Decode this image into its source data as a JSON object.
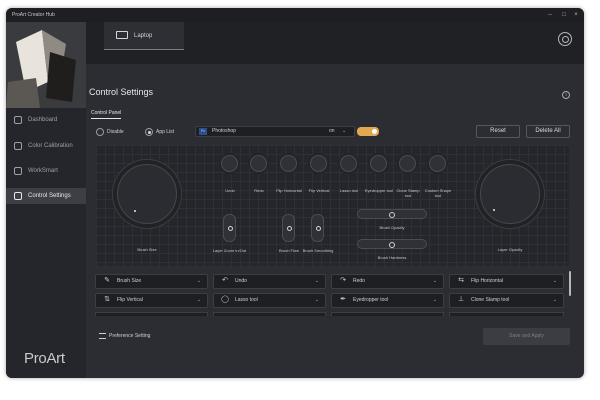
{
  "window": {
    "title": "ProArt Creator Hub",
    "minimize": "–",
    "maximize": "□",
    "close": "×"
  },
  "sidebar": {
    "items": [
      {
        "label": "Dashboard",
        "icon": "dashboard-icon"
      },
      {
        "label": "Color Calibration",
        "icon": "color-calibration-icon"
      },
      {
        "label": "WorkSmart",
        "icon": "worksmart-icon"
      },
      {
        "label": "Control Settings",
        "icon": "sliders-icon",
        "active": true
      }
    ],
    "brand": "ProArt"
  },
  "header": {
    "device_tab": "Laptop",
    "settings_icon": "gear-icon"
  },
  "page": {
    "title": "Control Settings",
    "subtab": "Control Panel",
    "info_icon": "info-icon"
  },
  "mode": {
    "disable": "Disable",
    "app_list": "App List",
    "selected": "App List"
  },
  "app": {
    "badge": "Ps",
    "name": "Photoshop",
    "state": "on",
    "toggle_on": true
  },
  "buttons": {
    "reset": "Reset",
    "delete_all": "Delete All",
    "save_apply": "Save and Apply"
  },
  "panel": {
    "left_knob": "Brush Size",
    "right_knob": "Layer Opacity",
    "buttons": [
      "Undo",
      "Redo",
      "Flip Horizontal",
      "Flip Vertical",
      "Lasso tool",
      "Eyedropper tool",
      "Clone Stamp tool",
      "Custom Shape tool"
    ],
    "sliders": [
      "Layer Zoom In/Out",
      "Brush Flow",
      "Brush Smoothing"
    ],
    "hsliders": [
      "Brush Opacity",
      "Brush Hardness"
    ]
  },
  "assignments": [
    {
      "label": "Brush Size",
      "icon": "brush-size-icon",
      "glyph": "✎"
    },
    {
      "label": "Undo",
      "icon": "undo-icon",
      "glyph": "↶"
    },
    {
      "label": "Redo",
      "icon": "redo-icon",
      "glyph": "↷"
    },
    {
      "label": "Flip Horizontal",
      "icon": "flip-horizontal-icon",
      "glyph": "⇆"
    },
    {
      "label": "Flip Vertical",
      "icon": "flip-vertical-icon",
      "glyph": "⇅"
    },
    {
      "label": "Lasso tool",
      "icon": "lasso-icon",
      "glyph": "◯"
    },
    {
      "label": "Eyedropper tool",
      "icon": "eyedropper-icon",
      "glyph": "✒"
    },
    {
      "label": "Clone Stamp tool",
      "icon": "clone-stamp-icon",
      "glyph": "⊥"
    }
  ],
  "preference": "Preference Setting",
  "colors": {
    "accent": "#e0a850",
    "bg": "#2b2d33",
    "sidebar": "#24262b"
  }
}
